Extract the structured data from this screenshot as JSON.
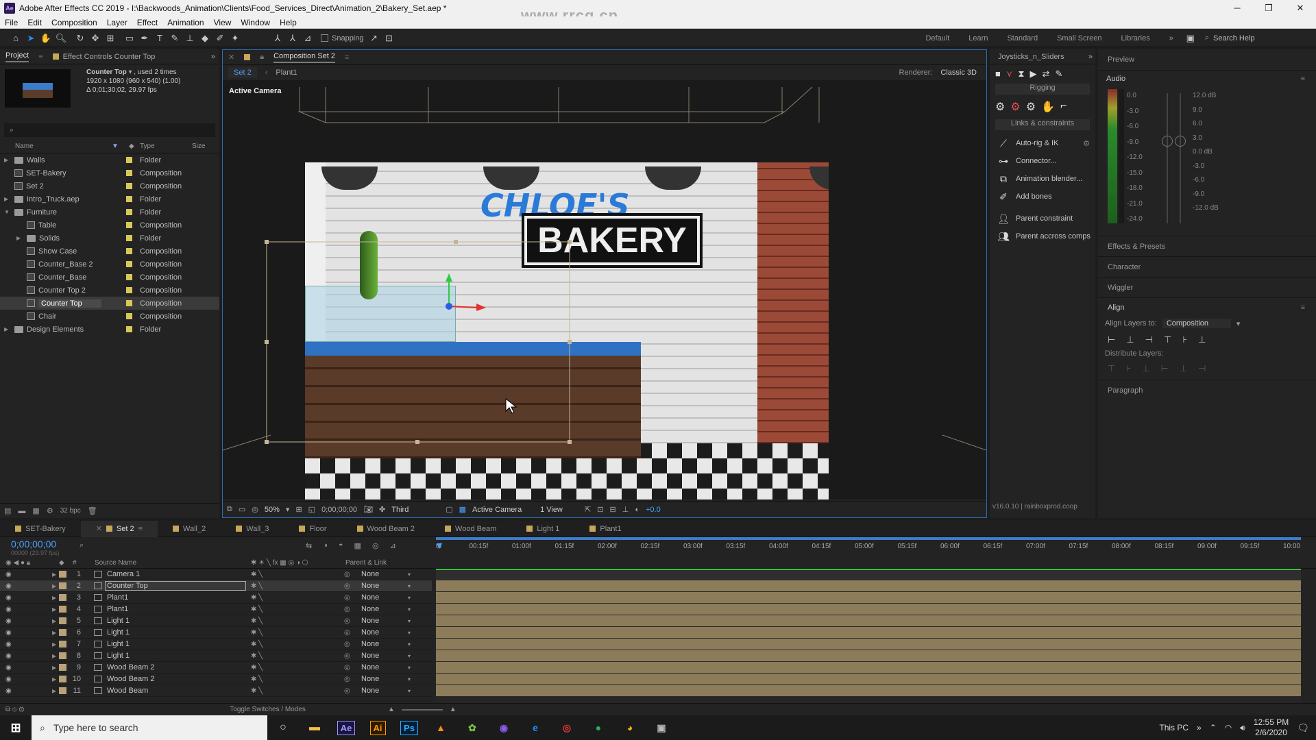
{
  "window": {
    "title": "Adobe After Effects CC 2019 - I:\\Backwoods_Animation\\Clients\\Food_Services_Direct\\Animation_2\\Bakery_Set.aep *",
    "logo": "Ae",
    "watermark": "www.rrcg.cn",
    "minimize": "─",
    "maximize": "❐",
    "close": "✕"
  },
  "menu": [
    "File",
    "Edit",
    "Composition",
    "Layer",
    "Effect",
    "Animation",
    "View",
    "Window",
    "Help"
  ],
  "toolbar": {
    "snapping_label": "Snapping",
    "workspaces": [
      "Default",
      "Learn",
      "Standard",
      "Small Screen",
      "Libraries"
    ],
    "more": "»",
    "search_help": "Search Help"
  },
  "project_panel": {
    "tabs": [
      "Project",
      "Effect Controls Counter Top"
    ],
    "selected_item": "Counter Top",
    "used_info": ", used 2 times",
    "dimensions": "1920 x 1080  (960 x 540) (1.00)",
    "duration": "Δ 0;01;30;02, 29.97 fps",
    "columns": {
      "name": "Name",
      "type": "Type",
      "size": "Size"
    },
    "items": [
      {
        "name": "Walls",
        "type": "Folder",
        "kind": "folder",
        "indent": 0,
        "expand": "▶"
      },
      {
        "name": "SET-Bakery",
        "type": "Composition",
        "kind": "comp",
        "indent": 0,
        "expand": ""
      },
      {
        "name": "Set 2",
        "type": "Composition",
        "kind": "comp",
        "indent": 0,
        "expand": ""
      },
      {
        "name": "Intro_Truck.aep",
        "type": "Folder",
        "kind": "folder",
        "indent": 0,
        "expand": "▶"
      },
      {
        "name": "Furniture",
        "type": "Folder",
        "kind": "folder",
        "indent": 0,
        "expand": "▼"
      },
      {
        "name": "Table",
        "type": "Composition",
        "kind": "comp",
        "indent": 1,
        "expand": ""
      },
      {
        "name": "Solids",
        "type": "Folder",
        "kind": "folder",
        "indent": 1,
        "expand": "▶"
      },
      {
        "name": "Show Case",
        "type": "Composition",
        "kind": "comp",
        "indent": 1,
        "expand": ""
      },
      {
        "name": "Counter_Base 2",
        "type": "Composition",
        "kind": "comp",
        "indent": 1,
        "expand": ""
      },
      {
        "name": "Counter_Base",
        "type": "Composition",
        "kind": "comp",
        "indent": 1,
        "expand": ""
      },
      {
        "name": "Counter Top 2",
        "type": "Composition",
        "kind": "comp",
        "indent": 1,
        "expand": ""
      },
      {
        "name": "Counter Top",
        "type": "Composition",
        "kind": "comp",
        "indent": 1,
        "expand": "",
        "selected": true
      },
      {
        "name": "Chair",
        "type": "Composition",
        "kind": "comp",
        "indent": 1,
        "expand": ""
      },
      {
        "name": "Design Elements",
        "type": "Folder",
        "kind": "folder",
        "indent": 0,
        "expand": "▶"
      }
    ],
    "bpc": "32 bpc"
  },
  "composition_panel": {
    "tab_label": "Composition Set 2",
    "breadcrumbs": [
      "Set 2",
      "Plant1"
    ],
    "renderer_label": "Renderer:",
    "renderer": "Classic 3D",
    "active_camera": "Active Camera",
    "sign_script": "CHLOE'S",
    "sign_main": "BAKERY",
    "zoom": "50%",
    "timecode": "0;00;00;00",
    "resolution": "Third",
    "camera": "Active Camera",
    "views": "1 View",
    "exposure": "+0.0"
  },
  "joysticks_panel": {
    "title": "Joysticks_n_Sliders",
    "rigging_label": "Rigging",
    "links_label": "Links & constraints",
    "buttons": [
      "Auto-rig & IK",
      "Connector...",
      "Animation blender...",
      "Add bones",
      "Parent constraint",
      "Parent accross comps"
    ],
    "version": "v16.0.10 | rainboxprod.coop"
  },
  "right_panel": {
    "preview": "Preview",
    "audio": "Audio",
    "meter_left": [
      "0.0",
      "-3.0",
      "-6.0",
      "-9.0",
      "-12.0",
      "-15.0",
      "-18.0",
      "-21.0",
      "-24.0"
    ],
    "meter_right": [
      "12.0 dB",
      "9.0",
      "6.0",
      "3.0",
      "0.0 dB",
      "-3.0",
      "-6.0",
      "-9.0",
      "-12.0 dB"
    ],
    "sections": [
      "Effects & Presets",
      "Character",
      "Wiggler"
    ],
    "align": "Align",
    "align_to_label": "Align Layers to:",
    "align_to": "Composition",
    "distribute": "Distribute Layers:",
    "paragraph": "Paragraph"
  },
  "timeline": {
    "tabs": [
      {
        "label": "SET-Bakery",
        "active": false
      },
      {
        "label": "Set 2",
        "active": true
      },
      {
        "label": "Wall_2",
        "active": false
      },
      {
        "label": "Wall_3",
        "active": false
      },
      {
        "label": "Floor",
        "active": false
      },
      {
        "label": "Wood Beam 2",
        "active": false
      },
      {
        "label": "Wood Beam",
        "active": false
      },
      {
        "label": "Light 1",
        "active": false
      },
      {
        "label": "Plant1",
        "active": false
      }
    ],
    "timecode": "0;00;00;00",
    "fps": "00000 (29.97 fps)",
    "col_source": "Source Name",
    "col_parent": "Parent & Link",
    "ruler": [
      "0f",
      "00:15f",
      "01:00f",
      "01:15f",
      "02:00f",
      "02:15f",
      "03:00f",
      "03:15f",
      "04:00f",
      "04:15f",
      "05:00f",
      "05:15f",
      "06:00f",
      "06:15f",
      "07:00f",
      "07:15f",
      "08:00f",
      "08:15f",
      "09:00f",
      "09:15f",
      "10:00"
    ],
    "layers": [
      {
        "num": "1",
        "name": "Camera 1",
        "parent": "None"
      },
      {
        "num": "2",
        "name": "Counter Top",
        "parent": "None",
        "selected": true
      },
      {
        "num": "3",
        "name": "Plant1",
        "parent": "None"
      },
      {
        "num": "4",
        "name": "Plant1",
        "parent": "None"
      },
      {
        "num": "5",
        "name": "Light 1",
        "parent": "None"
      },
      {
        "num": "6",
        "name": "Light 1",
        "parent": "None"
      },
      {
        "num": "7",
        "name": "Light 1",
        "parent": "None"
      },
      {
        "num": "8",
        "name": "Light 1",
        "parent": "None"
      },
      {
        "num": "9",
        "name": "Wood Beam 2",
        "parent": "None"
      },
      {
        "num": "10",
        "name": "Wood Beam 2",
        "parent": "None"
      },
      {
        "num": "11",
        "name": "Wood Beam",
        "parent": "None"
      }
    ],
    "toggle_label": "Toggle Switches / Modes"
  },
  "taskbar": {
    "search_placeholder": "Type here to search",
    "apps": [
      {
        "label": "Ae",
        "color": "#9999ff",
        "bg": "#1c1440"
      },
      {
        "label": "Ai",
        "color": "#ff9a00",
        "bg": "#2b1a00"
      },
      {
        "label": "Ps",
        "color": "#31a8ff",
        "bg": "#001e36"
      }
    ],
    "this_pc": "This PC",
    "time": "12:55 PM",
    "date": "2/6/2020"
  },
  "colors": {
    "accent_blue": "#2d8ceb",
    "panel_bg": "#232323",
    "label_yellow": "#d8c85a"
  }
}
